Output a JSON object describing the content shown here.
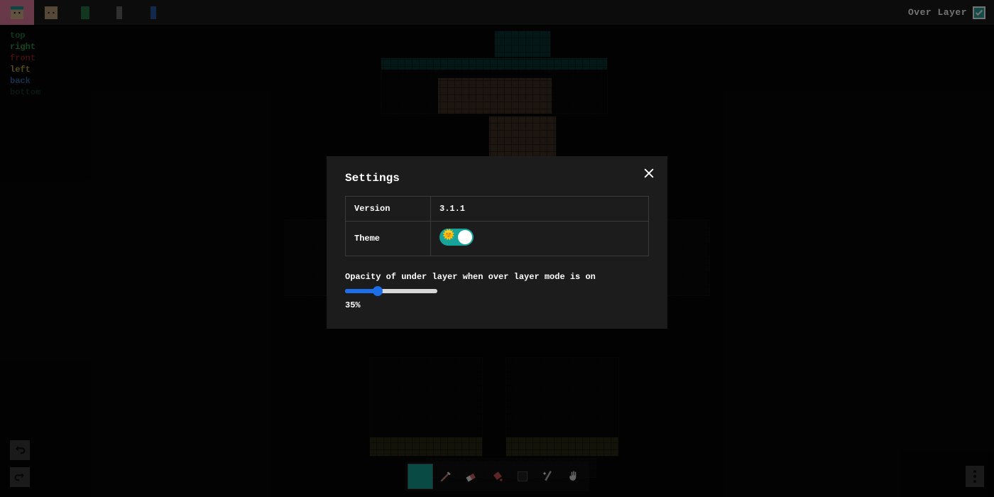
{
  "topbar": {
    "tabs": [
      {
        "name": "tab-head-full",
        "active": true
      },
      {
        "name": "tab-head",
        "active": false
      },
      {
        "name": "tab-body",
        "active": false
      },
      {
        "name": "tab-arm",
        "active": false
      },
      {
        "name": "tab-leg",
        "active": false
      }
    ],
    "over_layer_label": "Over Layer",
    "over_layer_checked": true
  },
  "faces": {
    "top": "top",
    "right": "right",
    "front": "front",
    "left": "left",
    "back": "back",
    "bottom": "bottom"
  },
  "toolbar": {
    "tools": [
      {
        "name": "color-swatch",
        "icon": "swatch",
        "active": true
      },
      {
        "name": "pencil-tool",
        "icon": "pencil",
        "active": false
      },
      {
        "name": "eraser-tool",
        "icon": "eraser",
        "active": false
      },
      {
        "name": "bucket-tool",
        "icon": "bucket",
        "active": false
      },
      {
        "name": "shade-tool",
        "icon": "shade",
        "active": false
      },
      {
        "name": "wand-tool",
        "icon": "wand",
        "active": false
      },
      {
        "name": "hand-tool",
        "icon": "hand",
        "active": false
      }
    ]
  },
  "modal": {
    "title": "Settings",
    "rows": {
      "version_label": "Version",
      "version_value": "3.1.1",
      "theme_label": "Theme",
      "theme_on": true
    },
    "opacity_label": "Opacity of under layer when over layer mode is on",
    "opacity_percent": 35,
    "opacity_display": "35%"
  },
  "colors": {
    "accent": "#16a49a",
    "modal_bg": "#1c1c1c",
    "slider_blue": "#1c6fe8",
    "tab_active": "#e77fa3"
  }
}
